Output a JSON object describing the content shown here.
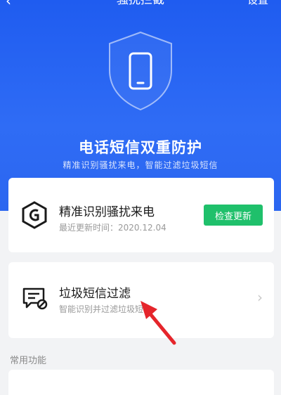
{
  "header": {
    "back_glyph": "‹",
    "title": "骚扰拦截",
    "settings_label": "设置"
  },
  "hero": {
    "title": "电话短信双重防护",
    "subtitle": "精准识别骚扰来电，智能过滤垃圾短信",
    "shield_icon": "shield-phone-icon"
  },
  "cards": {
    "call": {
      "title": "精准识别骚扰来电",
      "subtitle": "最近更新时间：2020.12.04",
      "button_label": "检查更新",
      "icon": "shield-badge-icon"
    },
    "sms": {
      "title": "垃圾短信过滤",
      "subtitle": "智能识别并过滤垃圾短信",
      "chevron": "›",
      "icon": "message-block-icon"
    }
  },
  "section": {
    "label": "常用功能"
  },
  "colors": {
    "hero_blue": "#1f5cf0",
    "button_green": "#1fc06b",
    "arrow_red": "#e5252b"
  }
}
